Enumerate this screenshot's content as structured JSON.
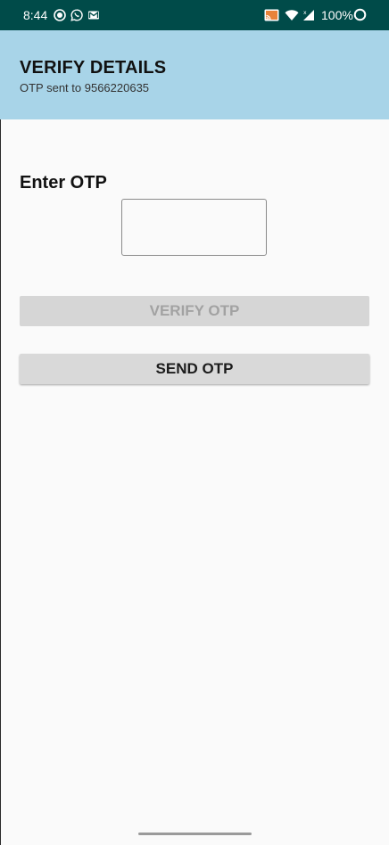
{
  "status_bar": {
    "time": "8:44",
    "battery": "100%",
    "background": "#004b49",
    "icons": [
      "record-icon",
      "whatsapp-icon",
      "gmail-icon",
      "cast-icon",
      "wifi-icon",
      "signal-icon",
      "battery-icon"
    ]
  },
  "header": {
    "title": "VERIFY DETAILS",
    "subtitle": "OTP sent to 9566220635",
    "background": "#a8d4e8"
  },
  "form": {
    "otp_label": "Enter OTP",
    "otp_value": "",
    "verify_button": "VERIFY OTP",
    "verify_enabled": false,
    "send_button": "SEND OTP"
  }
}
